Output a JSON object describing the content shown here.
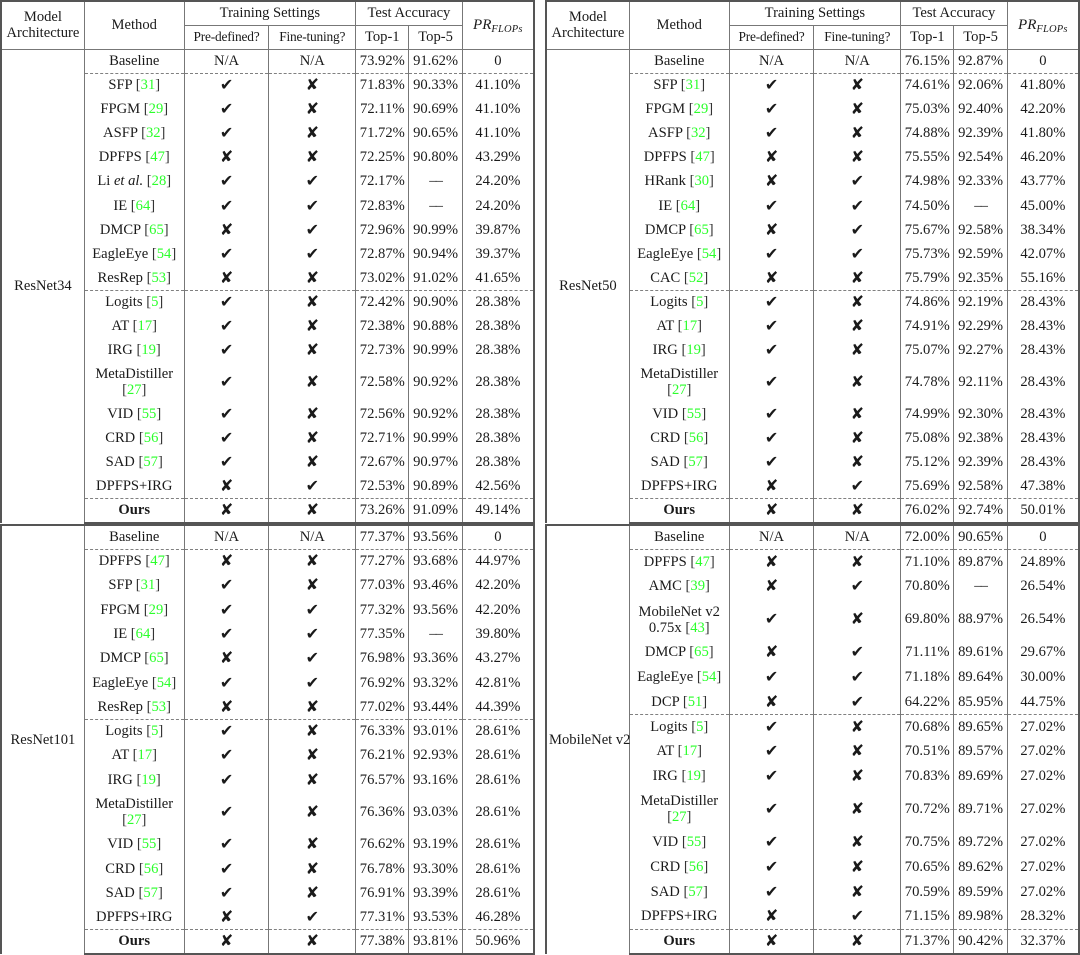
{
  "header": {
    "model_architecture": [
      "Model",
      "Architecture"
    ],
    "method": "Method",
    "training_settings": "Training Settings",
    "test_accuracy": "Test Accuracy",
    "pre_defined": "Pre-defined?",
    "fine_tuning": "Fine-tuning?",
    "top1": "Top-1",
    "top5": "Top-5",
    "pr_flops_base": "PR",
    "pr_flops_sub": "FLOPs"
  },
  "symbols": {
    "check": "✔",
    "cross": "✘",
    "na": "N/A",
    "none": "––",
    "zero": "0"
  },
  "colors": {
    "citation_green": "#2bff2b",
    "rule": "#777777",
    "dashed_rule": "#808080",
    "text": "#1a1a1a"
  },
  "tables": [
    {
      "architecture": "ResNet34",
      "rows": [
        {
          "method": "Baseline",
          "cite": null,
          "pre": "na",
          "fine": "na",
          "top1": "73.92%",
          "top5": "91.62%",
          "pr": "0",
          "sep_after": "dashed"
        },
        {
          "method": "SFP",
          "cite": "31",
          "pre": "check",
          "fine": "cross",
          "top1": "71.83%",
          "top5": "90.33%",
          "pr": "41.10%"
        },
        {
          "method": "FPGM",
          "cite": "29",
          "pre": "check",
          "fine": "cross",
          "top1": "72.11%",
          "top5": "90.69%",
          "pr": "41.10%"
        },
        {
          "method": "ASFP",
          "cite": "32",
          "pre": "check",
          "fine": "cross",
          "top1": "71.72%",
          "top5": "90.65%",
          "pr": "41.10%"
        },
        {
          "method": "DPFPS",
          "cite": "47",
          "pre": "cross",
          "fine": "cross",
          "top1": "72.25%",
          "top5": "90.80%",
          "pr": "43.29%"
        },
        {
          "method": "Li et al.",
          "cite": "28",
          "italic_part": "et al.",
          "pre": "check",
          "fine": "check",
          "top1": "72.17%",
          "top5": "none",
          "pr": "24.20%"
        },
        {
          "method": "IE",
          "cite": "64",
          "pre": "check",
          "fine": "check",
          "top1": "72.83%",
          "top5": "none",
          "pr": "24.20%"
        },
        {
          "method": "DMCP",
          "cite": "65",
          "pre": "cross",
          "fine": "check",
          "top1": "72.96%",
          "top5": "90.99%",
          "pr": "39.87%"
        },
        {
          "method": "EagleEye",
          "cite": "54",
          "pre": "check",
          "fine": "check",
          "top1": "72.87%",
          "top5": "90.94%",
          "pr": "39.37%"
        },
        {
          "method": "ResRep",
          "cite": "53",
          "pre": "cross",
          "fine": "cross",
          "top1": "73.02%",
          "top5": "91.02%",
          "pr": "41.65%",
          "sep_after": "dashed"
        },
        {
          "method": "Logits",
          "cite": "5",
          "pre": "check",
          "fine": "cross",
          "top1": "72.42%",
          "top5": "90.90%",
          "pr": "28.38%"
        },
        {
          "method": "AT",
          "cite": "17",
          "pre": "check",
          "fine": "cross",
          "top1": "72.38%",
          "top5": "90.88%",
          "pr": "28.38%"
        },
        {
          "method": "IRG",
          "cite": "19",
          "pre": "check",
          "fine": "cross",
          "top1": "72.73%",
          "top5": "90.99%",
          "pr": "28.38%"
        },
        {
          "method": "MetaDistiller",
          "cite": "27",
          "two_line": true,
          "pre": "check",
          "fine": "cross",
          "top1": "72.58%",
          "top5": "90.92%",
          "pr": "28.38%"
        },
        {
          "method": "VID",
          "cite": "55",
          "pre": "check",
          "fine": "cross",
          "top1": "72.56%",
          "top5": "90.92%",
          "pr": "28.38%"
        },
        {
          "method": "CRD",
          "cite": "56",
          "pre": "check",
          "fine": "cross",
          "top1": "72.71%",
          "top5": "90.99%",
          "pr": "28.38%"
        },
        {
          "method": "SAD",
          "cite": "57",
          "pre": "check",
          "fine": "cross",
          "top1": "72.67%",
          "top5": "90.97%",
          "pr": "28.38%"
        },
        {
          "method": "DPFPS+IRG",
          "cite": null,
          "pre": "cross",
          "fine": "check",
          "top1": "72.53%",
          "top5": "90.89%",
          "pr": "42.56%",
          "sep_after": "dashed"
        },
        {
          "method": "Ours",
          "cite": null,
          "bold_method": true,
          "pre": "cross",
          "fine": "cross",
          "top1": "73.26%",
          "top5": "91.09%",
          "pr": "49.14%",
          "bold_top1": true,
          "bold_top5": true,
          "bold_pr": true
        }
      ]
    },
    {
      "architecture": "ResNet50",
      "rows": [
        {
          "method": "Baseline",
          "cite": null,
          "pre": "na",
          "fine": "na",
          "top1": "76.15%",
          "top5": "92.87%",
          "pr": "0",
          "sep_after": "dashed"
        },
        {
          "method": "SFP",
          "cite": "31",
          "pre": "check",
          "fine": "cross",
          "top1": "74.61%",
          "top5": "92.06%",
          "pr": "41.80%"
        },
        {
          "method": "FPGM",
          "cite": "29",
          "pre": "check",
          "fine": "cross",
          "top1": "75.03%",
          "top5": "92.40%",
          "pr": "42.20%"
        },
        {
          "method": "ASFP",
          "cite": "32",
          "pre": "check",
          "fine": "cross",
          "top1": "74.88%",
          "top5": "92.39%",
          "pr": "41.80%"
        },
        {
          "method": "DPFPS",
          "cite": "47",
          "pre": "cross",
          "fine": "cross",
          "top1": "75.55%",
          "top5": "92.54%",
          "pr": "46.20%"
        },
        {
          "method": "HRank",
          "cite": "30",
          "pre": "cross",
          "fine": "check",
          "top1": "74.98%",
          "top5": "92.33%",
          "pr": "43.77%"
        },
        {
          "method": "IE",
          "cite": "64",
          "pre": "check",
          "fine": "check",
          "top1": "74.50%",
          "top5": "none",
          "pr": "45.00%"
        },
        {
          "method": "DMCP",
          "cite": "65",
          "pre": "cross",
          "fine": "check",
          "top1": "75.67%",
          "top5": "92.58%",
          "pr": "38.34%"
        },
        {
          "method": "EagleEye",
          "cite": "54",
          "pre": "check",
          "fine": "check",
          "top1": "75.73%",
          "top5": "92.59%",
          "pr": "42.07%"
        },
        {
          "method": "CAC",
          "cite": "52",
          "pre": "cross",
          "fine": "cross",
          "top1": "75.79%",
          "top5": "92.35%",
          "pr": "55.16%",
          "bold_pr": true,
          "sep_after": "dashed"
        },
        {
          "method": "Logits",
          "cite": "5",
          "pre": "check",
          "fine": "cross",
          "top1": "74.86%",
          "top5": "92.19%",
          "pr": "28.43%"
        },
        {
          "method": "AT",
          "cite": "17",
          "pre": "check",
          "fine": "cross",
          "top1": "74.91%",
          "top5": "92.29%",
          "pr": "28.43%"
        },
        {
          "method": "IRG",
          "cite": "19",
          "pre": "check",
          "fine": "cross",
          "top1": "75.07%",
          "top5": "92.27%",
          "pr": "28.43%"
        },
        {
          "method": "MetaDistiller",
          "cite": "27",
          "two_line": true,
          "pre": "check",
          "fine": "cross",
          "top1": "74.78%",
          "top5": "92.11%",
          "pr": "28.43%"
        },
        {
          "method": "VID",
          "cite": "55",
          "pre": "check",
          "fine": "cross",
          "top1": "74.99%",
          "top5": "92.30%",
          "pr": "28.43%"
        },
        {
          "method": "CRD",
          "cite": "56",
          "pre": "check",
          "fine": "cross",
          "top1": "75.08%",
          "top5": "92.38%",
          "pr": "28.43%"
        },
        {
          "method": "SAD",
          "cite": "57",
          "pre": "check",
          "fine": "cross",
          "top1": "75.12%",
          "top5": "92.39%",
          "pr": "28.43%"
        },
        {
          "method": "DPFPS+IRG",
          "cite": null,
          "pre": "cross",
          "fine": "check",
          "top1": "75.69%",
          "top5": "92.58%",
          "pr": "47.38%",
          "sep_after": "dashed"
        },
        {
          "method": "Ours",
          "cite": null,
          "bold_method": true,
          "pre": "cross",
          "fine": "cross",
          "top1": "76.02%",
          "top5": "92.74%",
          "pr": "50.01%",
          "bold_top1": true,
          "bold_top5": true
        }
      ]
    },
    {
      "architecture": "ResNet101",
      "rows": [
        {
          "method": "Baseline",
          "cite": null,
          "pre": "na",
          "fine": "na",
          "top1": "77.37%",
          "top5": "93.56%",
          "pr": "0",
          "sep_after": "dashed"
        },
        {
          "method": "DPFPS",
          "cite": "47",
          "pre": "cross",
          "fine": "cross",
          "top1": "77.27%",
          "top5": "93.68%",
          "pr": "44.97%"
        },
        {
          "method": "SFP",
          "cite": "31",
          "pre": "check",
          "fine": "cross",
          "top1": "77.03%",
          "top5": "93.46%",
          "pr": "42.20%"
        },
        {
          "method": "FPGM",
          "cite": "29",
          "pre": "check",
          "fine": "check",
          "top1": "77.32%",
          "top5": "93.56%",
          "pr": "42.20%"
        },
        {
          "method": "IE",
          "cite": "64",
          "pre": "check",
          "fine": "check",
          "top1": "77.35%",
          "top5": "none",
          "pr": "39.80%"
        },
        {
          "method": "DMCP",
          "cite": "65",
          "pre": "cross",
          "fine": "check",
          "top1": "76.98%",
          "top5": "93.36%",
          "pr": "43.27%"
        },
        {
          "method": "EagleEye",
          "cite": "54",
          "pre": "check",
          "fine": "check",
          "top1": "76.92%",
          "top5": "93.32%",
          "pr": "42.81%"
        },
        {
          "method": "ResRep",
          "cite": "53",
          "pre": "cross",
          "fine": "cross",
          "top1": "77.02%",
          "top5": "93.44%",
          "pr": "44.39%",
          "sep_after": "dashed"
        },
        {
          "method": "Logits",
          "cite": "5",
          "pre": "check",
          "fine": "cross",
          "top1": "76.33%",
          "top5": "93.01%",
          "pr": "28.61%"
        },
        {
          "method": "AT",
          "cite": "17",
          "pre": "check",
          "fine": "cross",
          "top1": "76.21%",
          "top5": "92.93%",
          "pr": "28.61%"
        },
        {
          "method": "IRG",
          "cite": "19",
          "pre": "check",
          "fine": "cross",
          "top1": "76.57%",
          "top5": "93.16%",
          "pr": "28.61%"
        },
        {
          "method": "MetaDistiller",
          "cite": "27",
          "two_line": true,
          "pre": "check",
          "fine": "cross",
          "top1": "76.36%",
          "top5": "93.03%",
          "pr": "28.61%"
        },
        {
          "method": "VID",
          "cite": "55",
          "pre": "check",
          "fine": "cross",
          "top1": "76.62%",
          "top5": "93.19%",
          "pr": "28.61%"
        },
        {
          "method": "CRD",
          "cite": "56",
          "pre": "check",
          "fine": "cross",
          "top1": "76.78%",
          "top5": "93.30%",
          "pr": "28.61%"
        },
        {
          "method": "SAD",
          "cite": "57",
          "pre": "check",
          "fine": "cross",
          "top1": "76.91%",
          "top5": "93.39%",
          "pr": "28.61%"
        },
        {
          "method": "DPFPS+IRG",
          "cite": null,
          "pre": "cross",
          "fine": "check",
          "top1": "77.31%",
          "top5": "93.53%",
          "pr": "46.28%",
          "sep_after": "dashed"
        },
        {
          "method": "Ours",
          "cite": null,
          "bold_method": true,
          "pre": "cross",
          "fine": "cross",
          "top1": "77.38%",
          "top5": "93.81%",
          "pr": "50.96%",
          "bold_top1": true,
          "bold_top5": true,
          "bold_pr": true
        }
      ]
    },
    {
      "architecture": "MobileNet v2",
      "rows": [
        {
          "method": "Baseline",
          "cite": null,
          "pre": "na",
          "fine": "na",
          "top1": "72.00%",
          "top5": "90.65%",
          "pr": "0",
          "sep_after": "dashed"
        },
        {
          "method": "DPFPS",
          "cite": "47",
          "pre": "cross",
          "fine": "cross",
          "top1": "71.10%",
          "top5": "89.87%",
          "pr": "24.89%"
        },
        {
          "method": "AMC",
          "cite": "39",
          "pre": "cross",
          "fine": "check",
          "top1": "70.80%",
          "top5": "none",
          "pr": "26.54%"
        },
        {
          "method": "MobileNet v2 0.75x",
          "cite": "43",
          "two_line": true,
          "line1": "MobileNet v2",
          "line2": "0.75x",
          "pre": "check",
          "fine": "cross",
          "top1": "69.80%",
          "top5": "88.97%",
          "pr": "26.54%"
        },
        {
          "method": "DMCP",
          "cite": "65",
          "pre": "cross",
          "fine": "check",
          "top1": "71.11%",
          "top5": "89.61%",
          "pr": "29.67%"
        },
        {
          "method": "EagleEye",
          "cite": "54",
          "pre": "check",
          "fine": "check",
          "top1": "71.18%",
          "top5": "89.64%",
          "pr": "30.00%"
        },
        {
          "method": "DCP",
          "cite": "51",
          "pre": "cross",
          "fine": "check",
          "top1": "64.22%",
          "top5": "85.95%",
          "pr": "44.75%",
          "sep_after": "dashed"
        },
        {
          "method": "Logits",
          "cite": "5",
          "pre": "check",
          "fine": "cross",
          "top1": "70.68%",
          "top5": "89.65%",
          "pr": "27.02%"
        },
        {
          "method": "AT",
          "cite": "17",
          "pre": "check",
          "fine": "cross",
          "top1": "70.51%",
          "top5": "89.57%",
          "pr": "27.02%"
        },
        {
          "method": "IRG",
          "cite": "19",
          "pre": "check",
          "fine": "cross",
          "top1": "70.83%",
          "top5": "89.69%",
          "pr": "27.02%"
        },
        {
          "method": "MetaDistiller",
          "cite": "27",
          "two_line": true,
          "pre": "check",
          "fine": "cross",
          "top1": "70.72%",
          "top5": "89.71%",
          "pr": "27.02%"
        },
        {
          "method": "VID",
          "cite": "55",
          "pre": "check",
          "fine": "cross",
          "top1": "70.75%",
          "top5": "89.72%",
          "pr": "27.02%"
        },
        {
          "method": "CRD",
          "cite": "56",
          "pre": "check",
          "fine": "cross",
          "top1": "70.65%",
          "top5": "89.62%",
          "pr": "27.02%"
        },
        {
          "method": "SAD",
          "cite": "57",
          "pre": "check",
          "fine": "cross",
          "top1": "70.59%",
          "top5": "89.59%",
          "pr": "27.02%"
        },
        {
          "method": "DPFPS+IRG",
          "cite": null,
          "pre": "cross",
          "fine": "check",
          "top1": "71.15%",
          "top5": "89.98%",
          "pr": "28.32%",
          "sep_after": "dashed"
        },
        {
          "method": "Ours",
          "cite": null,
          "bold_method": true,
          "pre": "cross",
          "fine": "cross",
          "top1": "71.37%",
          "top5": "90.42%",
          "pr": "32.37%",
          "bold_top1": true,
          "bold_top5": true,
          "bold_pr": true
        }
      ]
    }
  ]
}
